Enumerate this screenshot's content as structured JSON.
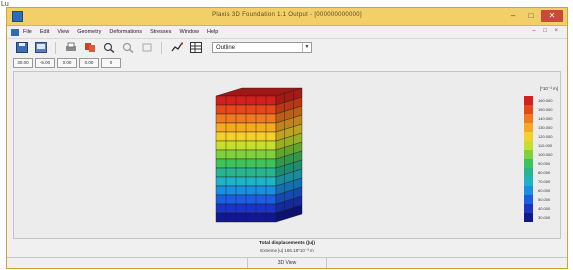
{
  "corner_label": "Lu",
  "window": {
    "title": "Plaxis 3D Foundation 1.1 Output - [000000000000]",
    "controls": {
      "minimize": "–",
      "maximize": "□",
      "close": "✕"
    }
  },
  "menubar": {
    "items": [
      "File",
      "Edit",
      "View",
      "Geometry",
      "Deformations",
      "Stresses",
      "Window",
      "Help"
    ],
    "mdi_controls": "– □ ×"
  },
  "toolbar": {
    "icons": [
      "save-icon",
      "open-icon",
      "print-icon",
      "copy-icon",
      "zoom-in-icon",
      "zoom-out-icon",
      "reset-view-icon",
      "chart-icon",
      "table-icon"
    ],
    "select_value": "Outline",
    "select_arrow": "▼"
  },
  "view_buttons": [
    "30.00",
    "-5.00",
    "0.00",
    "0.00",
    "0"
  ],
  "legend": {
    "title": "[*10⁻³ m]",
    "entries": [
      {
        "label": "160.000",
        "color": "#d4201c"
      },
      {
        "label": "150.000",
        "color": "#e8471c"
      },
      {
        "label": "140.000",
        "color": "#f07a1f"
      },
      {
        "label": "130.000",
        "color": "#f7a825"
      },
      {
        "label": "120.000",
        "color": "#f3d02a"
      },
      {
        "label": "110.000",
        "color": "#c6df2c"
      },
      {
        "label": "100.000",
        "color": "#7ed13a"
      },
      {
        "label": "90.000",
        "color": "#3ec35c"
      },
      {
        "label": "80.000",
        "color": "#27b48f"
      },
      {
        "label": "70.000",
        "color": "#1fb3c8"
      },
      {
        "label": "60.000",
        "color": "#1a8ee0"
      },
      {
        "label": "50.000",
        "color": "#1a5fe0"
      },
      {
        "label": "40.000",
        "color": "#1a34c8"
      },
      {
        "label": "30.000",
        "color": "#10178f"
      }
    ]
  },
  "caption": {
    "line1": "Total displacements (|u|)",
    "line2": "Extreme |u| 166.18*10⁻³ m"
  },
  "status": "3D View"
}
